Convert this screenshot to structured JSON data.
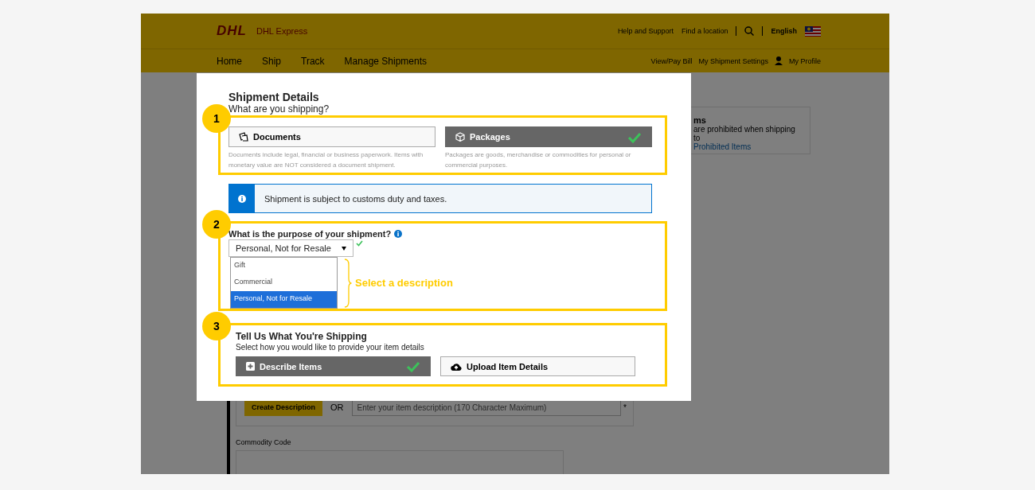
{
  "site": {
    "logo": "DHL",
    "brand": "DHL Express",
    "top_links": [
      "Help and Support",
      "Find a location"
    ],
    "language": "English",
    "nav": [
      "Home",
      "Ship",
      "Track",
      "Manage Shipments"
    ],
    "account_links": [
      "View/Pay Bill",
      "My Shipment Settings",
      "My Profile"
    ],
    "side_notice": {
      "title": "ms",
      "text": "are prohibited when shipping to",
      "link": "Prohibited Items"
    },
    "item_form": {
      "create_button": "Create Description",
      "or": "OR",
      "placeholder": "Enter your item description (170 Character Maximum)",
      "required_mark": "*",
      "commodity_label": "Commodity Code"
    }
  },
  "modal": {
    "title": "Shipment Details",
    "subtitle": "What are you shipping?",
    "section_1": {
      "step": "1",
      "options": [
        {
          "kind": "documents",
          "label": "Documents",
          "description": "Documents include legal, financial or business paperwork. Items with monetary value are NOT considered a document shipment.",
          "selected": false
        },
        {
          "kind": "packages",
          "label": "Packages",
          "description": "Packages are goods, merchandise or commodities for personal or commercial purposes.",
          "selected": true
        }
      ]
    },
    "notice": "Shipment is subject to customs duty and taxes.",
    "section_2": {
      "step": "2",
      "label": "What is the purpose of your shipment?",
      "select": {
        "value": "Personal, Not for Resale",
        "valid": true
      },
      "options": [
        {
          "label": "Gift",
          "selected": false
        },
        {
          "label": "Commercial",
          "selected": false
        },
        {
          "label": "Personal, Not for Resale",
          "selected": true
        }
      ],
      "callout": "Select a description"
    },
    "section_3": {
      "step": "3",
      "title": "Tell Us What You're Shipping",
      "subtitle": "Select how you would like to provide your item details",
      "options": [
        {
          "kind": "describe",
          "label": "Describe Items",
          "selected": true
        },
        {
          "kind": "upload",
          "label": "Upload Item Details",
          "selected": false
        }
      ]
    }
  }
}
